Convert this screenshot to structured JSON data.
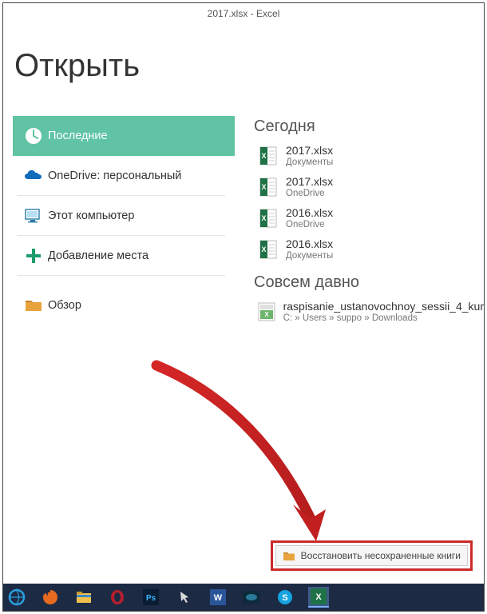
{
  "window_title": "2017.xlsx - Excel",
  "page_title": "Открыть",
  "sidebar": {
    "items": [
      {
        "label": "Последние"
      },
      {
        "label": "OneDrive: персональный"
      },
      {
        "label": "Этот компьютер"
      },
      {
        "label": "Добавление места"
      },
      {
        "label": "Обзор"
      }
    ]
  },
  "groups": [
    {
      "title": "Сегодня",
      "files": [
        {
          "name": "2017.xlsx",
          "location": "Документы"
        },
        {
          "name": "2017.xlsx",
          "location": "OneDrive"
        },
        {
          "name": "2016.xlsx",
          "location": "OneDrive"
        },
        {
          "name": "2016.xlsx",
          "location": "Документы"
        }
      ]
    },
    {
      "title": "Совсем давно",
      "files": [
        {
          "name": "raspisanie_ustanovochnoy_sessii_4_kur",
          "location": "C: » Users » suppo » Downloads"
        }
      ]
    }
  ],
  "recover_label": "Восстановить несохраненные книги"
}
